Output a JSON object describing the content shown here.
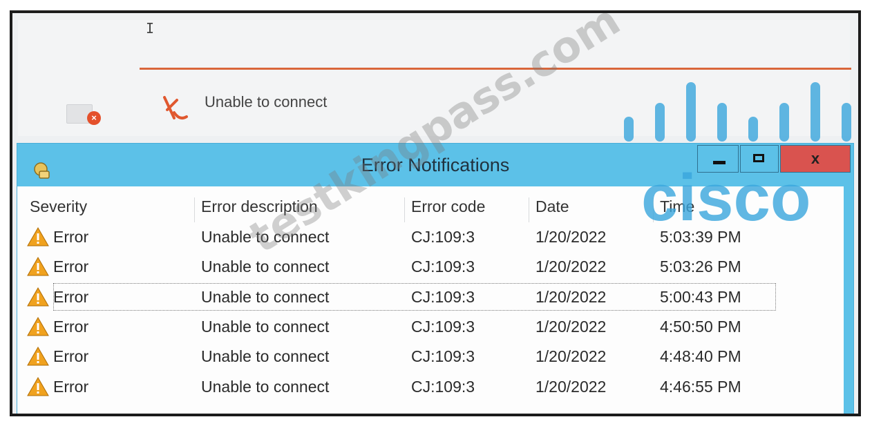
{
  "top_panel": {
    "cursor_glyph": "I",
    "status_text": "Unable to connect",
    "app_icon": "app-error-icon",
    "status_icon": "call-failed-icon",
    "accent_line_color": "#d9663a"
  },
  "window": {
    "title": "Error Notifications",
    "icon": "notification-icon",
    "titlebar_color": "#5cc1e8",
    "close_color": "#d9534f",
    "close_label": "x",
    "controls": [
      "minimize-icon",
      "maximize-icon",
      "close-icon"
    ]
  },
  "table": {
    "columns": [
      "Severity",
      "Error description",
      "Error code",
      "Date",
      "Time"
    ],
    "rows": [
      {
        "severity": "Error",
        "description": "Unable to connect",
        "code": "CJ:109:3",
        "date": "1/20/2022",
        "time": "5:03:39 PM"
      },
      {
        "severity": "Error",
        "description": "Unable to connect",
        "code": "CJ:109:3",
        "date": "1/20/2022",
        "time": "5:03:26 PM"
      },
      {
        "severity": "Error",
        "description": "Unable to connect",
        "code": "CJ:109:3",
        "date": "1/20/2022",
        "time": "5:00:43 PM"
      },
      {
        "severity": "Error",
        "description": "Unable to connect",
        "code": "CJ:109:3",
        "date": "1/20/2022",
        "time": "4:50:50 PM"
      },
      {
        "severity": "Error",
        "description": "Unable to connect",
        "code": "CJ:109:3",
        "date": "1/20/2022",
        "time": "4:48:40 PM"
      },
      {
        "severity": "Error",
        "description": "Unable to connect",
        "code": "CJ:109:3",
        "date": "1/20/2022",
        "time": "4:46:55 PM"
      }
    ],
    "selected_row": 2,
    "severity_icon": "warning-icon",
    "warning_color": "#f0a21f"
  },
  "watermarks": {
    "site_text": "testkingpass.com",
    "logo_text": "cisco",
    "logo_color": "#3aa6dd"
  }
}
